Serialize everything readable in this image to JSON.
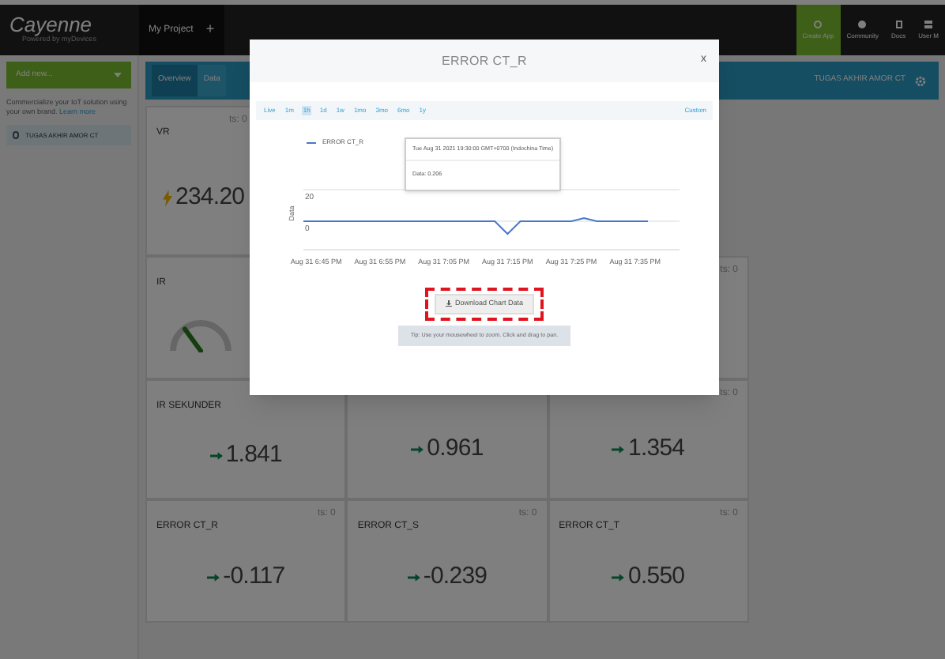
{
  "header": {
    "logo": "Cayenne",
    "logo_tagline": "Powered by myDevices",
    "project_tab": "My Project",
    "add_tab": "+",
    "nav": [
      {
        "label": "Create App",
        "kind": "create",
        "selected": true
      },
      {
        "label": "Community",
        "kind": "community",
        "selected": false
      },
      {
        "label": "Docs",
        "kind": "docs",
        "selected": false
      },
      {
        "label": "User M",
        "kind": "user",
        "selected": false
      }
    ]
  },
  "sidebar": {
    "add_new": "Add new...",
    "promo": "Commercialize your IoT solution using your own brand.",
    "promo_link": "Learn more",
    "device": "TUGAS AKHIR AMOR CT"
  },
  "toolbar": {
    "tabs": [
      {
        "label": "Overview",
        "selected": true
      },
      {
        "label": "Data",
        "selected": false
      }
    ],
    "device": "TUGAS AKHIR AMOR CT"
  },
  "tiles": [
    {
      "kind": "voltage",
      "title": "VR",
      "ts": "ts: 0",
      "value": "234.20"
    },
    {
      "kind": "hidden"
    },
    {
      "kind": "hidden"
    },
    {
      "kind": "gauge",
      "title": "IR",
      "level": 0.3
    },
    {
      "kind": "hidden"
    },
    {
      "kind": "blank",
      "ts": "ts: 0"
    },
    {
      "kind": "value",
      "title": "IR SEKUNDER",
      "value": "1.841"
    },
    {
      "kind": "value",
      "value": "0.961"
    },
    {
      "kind": "value",
      "ts": "ts: 0",
      "value": "1.354"
    },
    {
      "kind": "value",
      "title": "ERROR CT_R",
      "ts": "ts: 0",
      "value": "-0.117"
    },
    {
      "kind": "value",
      "title": "ERROR CT_S",
      "ts": "ts: 0",
      "value": "-0.239"
    },
    {
      "kind": "value",
      "title": "ERROR CT_T",
      "ts": "ts: 0",
      "value": "0.550"
    }
  ],
  "modal": {
    "title": "ERROR CT_R",
    "close": "x",
    "ranges": [
      {
        "label": "Live",
        "selected": false
      },
      {
        "label": "1m",
        "selected": false
      },
      {
        "label": "1h",
        "selected": true
      },
      {
        "label": "1d",
        "selected": false
      },
      {
        "label": "1w",
        "selected": false
      },
      {
        "label": "1mo",
        "selected": false
      },
      {
        "label": "3mo",
        "selected": false
      },
      {
        "label": "6mo",
        "selected": false
      },
      {
        "label": "1y",
        "selected": false
      }
    ],
    "custom": "Custom",
    "tooltip": {
      "time": "Tue Aug 31 2021 19:30:00 GMT+0700 (Indochina Time)",
      "value": "Data: 0.206"
    },
    "chart_data": {
      "type": "line",
      "ylabel": "Data",
      "categories": [
        null,
        "Aug 31 6:45 PM",
        null,
        null,
        null,
        null,
        "Aug 31 6:55 PM",
        null,
        null,
        null,
        null,
        "Aug 31 7:05 PM",
        null,
        null,
        null,
        null,
        "Aug 31 7:15 PM",
        null,
        null,
        null,
        null,
        "Aug 31 7:25 PM",
        null,
        null,
        null,
        null,
        "Aug 31 7:35 PM",
        null
      ],
      "series": [
        {
          "name": "ERROR CT_R",
          "color": "#4a78c8",
          "values": [
            0,
            0,
            0,
            0,
            0,
            0,
            0,
            0,
            0,
            0,
            0,
            0,
            0,
            0,
            0,
            0,
            -8,
            0,
            0,
            0,
            0,
            0,
            2,
            0,
            0,
            0,
            0,
            0
          ]
        }
      ],
      "ylim": [
        -18,
        20
      ],
      "yticks": [
        0,
        20
      ]
    },
    "download": "Download Chart Data",
    "highlight": true,
    "tip": "Tip: Use your mousewheel to zoom. Click and drag to pan."
  }
}
